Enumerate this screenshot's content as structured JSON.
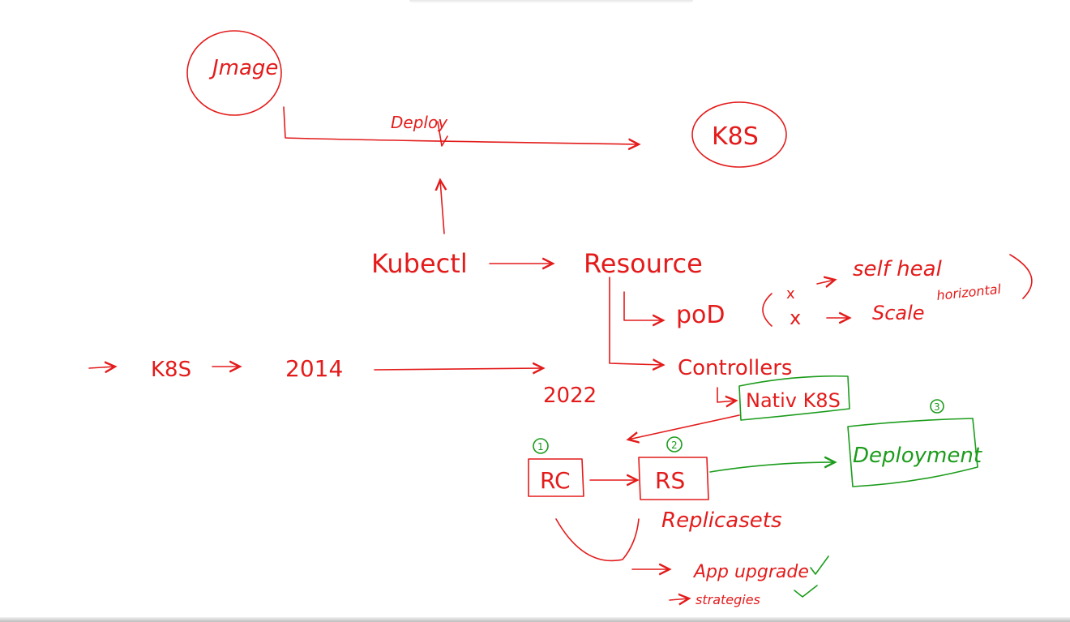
{
  "colors": {
    "ink_red": "#e31b1b",
    "ink_green": "#1c9c1c",
    "background": "#ffffff"
  },
  "labels": {
    "image": "Jmage",
    "deploy": "Deploy",
    "k8s_top": "K8S",
    "kubectl": "Kubectl",
    "resource": "Resource",
    "pod": "poD",
    "controllers": "Controllers",
    "self_heal": "self heal",
    "scale": "Scale",
    "horizontal": "horizontal",
    "x_mark_1": "x",
    "x_mark_2": "x",
    "timeline_k8s": "K8S",
    "year_2014": "2014",
    "year_2022": "2022",
    "native_k8s": "Nativ K8S",
    "rc": "RC",
    "rs": "RS",
    "replicasets": "Replicasets",
    "deployment": "Deployment",
    "num_1": "1",
    "num_2": "2",
    "num_3": "3",
    "app_upgrade": "App upgrade",
    "strategies": "strategies"
  }
}
